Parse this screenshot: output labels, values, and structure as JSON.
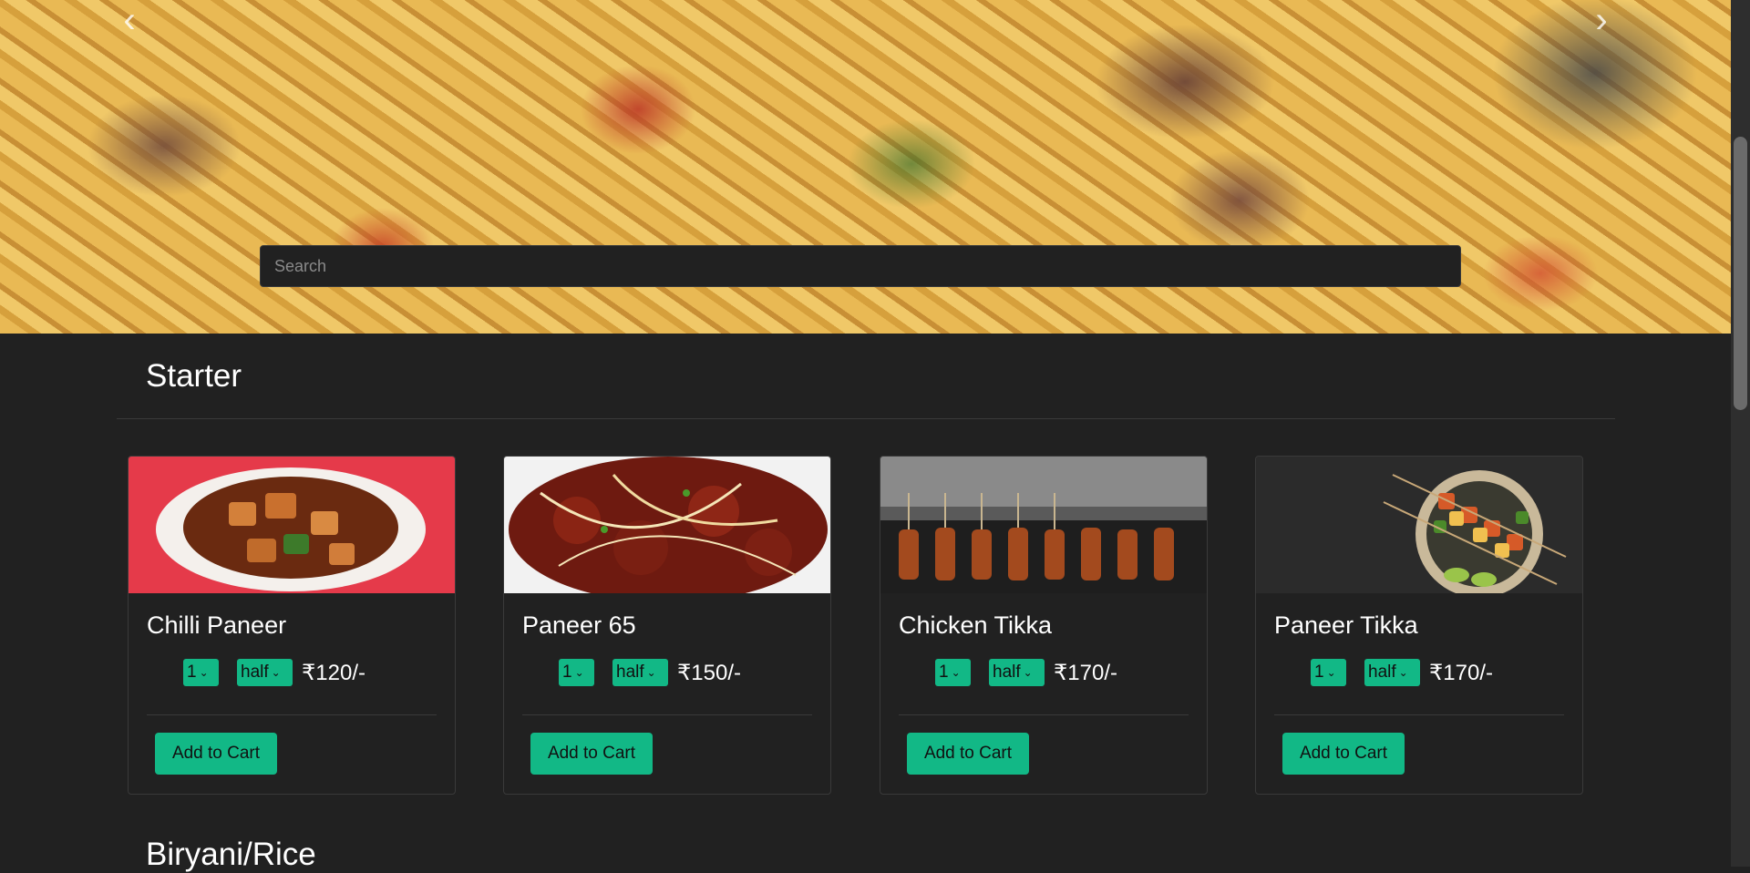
{
  "hero": {
    "prev_glyph": "‹",
    "next_glyph": "›"
  },
  "search": {
    "placeholder": "Search"
  },
  "sections": [
    {
      "title": "Starter",
      "items": [
        {
          "name": "Chilli Paneer",
          "qty": "1",
          "size": "half",
          "price": "₹120/-",
          "cta": "Add to Cart"
        },
        {
          "name": "Paneer 65",
          "qty": "1",
          "size": "half",
          "price": "₹150/-",
          "cta": "Add to Cart"
        },
        {
          "name": "Chicken Tikka",
          "qty": "1",
          "size": "half",
          "price": "₹170/-",
          "cta": "Add to Cart"
        },
        {
          "name": "Paneer Tikka",
          "qty": "1",
          "size": "half",
          "price": "₹170/-",
          "cta": "Add to Cart"
        }
      ]
    },
    {
      "title": "Biryani/Rice"
    }
  ],
  "colors": {
    "accent": "#12b886",
    "background": "#212121"
  },
  "icons": {
    "dropdown": "chevron-down-icon"
  }
}
